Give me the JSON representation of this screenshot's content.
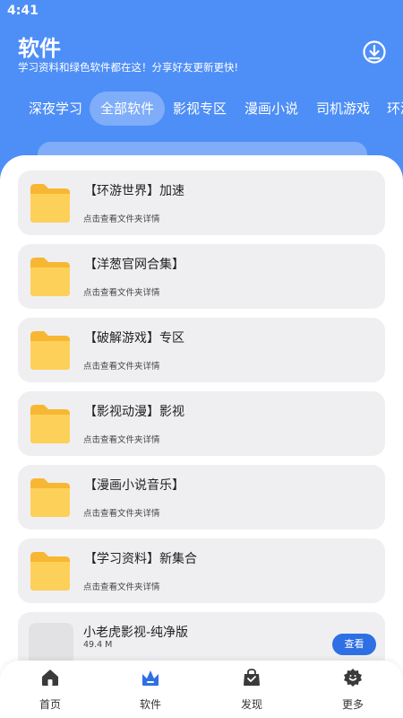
{
  "status_bar": {
    "time": "4:41"
  },
  "header": {
    "title": "软件",
    "subtitle": "学习资料和绿色软件都在这！分享好友更新更快!",
    "download_icon": "download-icon"
  },
  "tabs": [
    {
      "label": "深夜学习",
      "active": false
    },
    {
      "label": "全部软件",
      "active": true
    },
    {
      "label": "影视专区",
      "active": false
    },
    {
      "label": "漫画小说",
      "active": false
    },
    {
      "label": "司机游戏",
      "active": false
    },
    {
      "label": "环游",
      "active": false
    }
  ],
  "folders": [
    {
      "title": "【环游世界】加速",
      "subtitle": "点击查看文件夹详情"
    },
    {
      "title": "【洋葱官网合集】",
      "subtitle": "点击查看文件夹详情"
    },
    {
      "title": "【破解游戏】专区",
      "subtitle": "点击查看文件夹详情"
    },
    {
      "title": "【影视动漫】影视",
      "subtitle": "点击查看文件夹详情"
    },
    {
      "title": "【漫画小说音乐】",
      "subtitle": "点击查看文件夹详情"
    },
    {
      "title": "【学习资料】新集合",
      "subtitle": "点击查看文件夹详情"
    }
  ],
  "app_item": {
    "title": "小老虎影视-纯净版",
    "size": "49.4 M",
    "button": "查看"
  },
  "bottom_nav": [
    {
      "label": "首页",
      "icon": "home-icon",
      "active": false
    },
    {
      "label": "软件",
      "icon": "crown-icon",
      "active": true
    },
    {
      "label": "发现",
      "icon": "shopping-bag-icon",
      "active": false
    },
    {
      "label": "更多",
      "icon": "more-icon",
      "active": false
    }
  ],
  "colors": {
    "header_blue": "#4e8ef7",
    "accent_blue": "#2f6fe4",
    "folder_yellow": "#fdd05a",
    "card_bg": "#efeff1"
  }
}
